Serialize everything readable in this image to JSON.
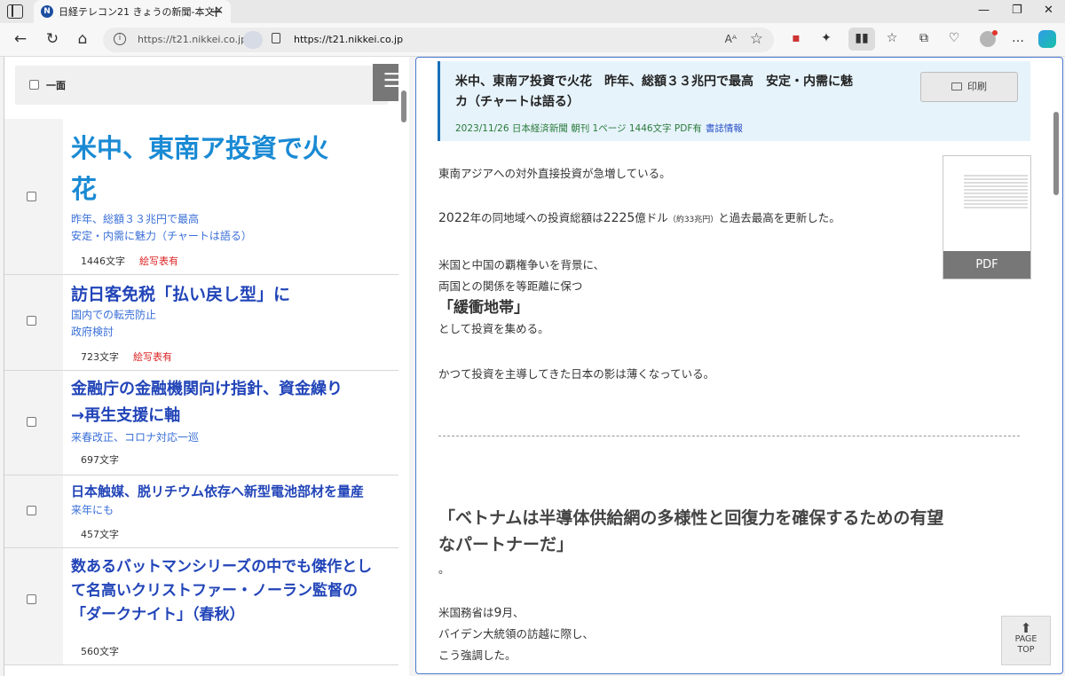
{
  "browser": {
    "tab_title": "日経テレコン21 きょうの新聞-本文",
    "address_host": "https://t21.nikkei.co.jp",
    "address_url": "https://t21.nikkei.co.jp"
  },
  "left": {
    "header_label": "一面",
    "menu_glyph": "☰",
    "articles": [
      {
        "title_line1": "米中、東南ア投資で火",
        "title_line2": "花",
        "sub_line1": "昨年、総額３３兆円で最高",
        "sub_line2": "安定・内需に魅力（チャートは語る）",
        "chars": "1446文字",
        "zu": "絵写表有"
      },
      {
        "title_line1": "訪日客免税「払い戻し型」に",
        "sub_line1": "国内での転売防止",
        "sub_line2": "政府検討",
        "chars": "723文字",
        "zu": "絵写表有"
      },
      {
        "title_line1": "金融庁の金融機関向け指針、資金繰り",
        "title_line2": "→再生支援に軸",
        "sub_line1": "来春改正、コロナ対応一巡",
        "chars": "697文字"
      },
      {
        "title_line1": "日本触媒、脱リチウム依存へ新型電池部材を量産",
        "sub_line1": "来年にも",
        "chars": "457文字"
      },
      {
        "title_line1": "数あるバットマンシリーズの中でも傑作とし",
        "title_line2": "て名高いクリストファー・ノーラン監督の",
        "title_line3": "「ダークナイト」（春秋）",
        "chars": "560文字"
      }
    ]
  },
  "article": {
    "title_line1": "米中、東南ア投資で火花　昨年、総額３３兆円で最高　安定・内需に魅",
    "title_line2": "カ（チャートは語る）",
    "meta": "2023/11/26 日本経済新聞 朝刊 1ページ 1446文字 PDF有",
    "biblio_link": "書誌情報",
    "print_label": "印刷",
    "pdf_label": "PDF",
    "p1": "東南アジアへの対外直接投資が急増している。",
    "p2_year": "2022",
    "p2_a": "年の同地域への投資総額は",
    "p2_amount": "2225",
    "p2_b": "億ドル",
    "p2_note": "（約33兆円）",
    "p2_c": "と過去最高を更新した。",
    "p3_line1": "米国と中国の覇権争いを背景に、",
    "p3_line2": "両国との関係を等距離に保つ",
    "p3_keyword": "「緩衝地帯」",
    "p3_line3": "として投資を集める。",
    "p4": "かつて投資を主導してきた日本の影は薄くなっている。",
    "quote_line1": "「ベトナムは半導体供給網の多様性と回復力を確保するための有望",
    "quote_line2": "なパートナーだ」",
    "quote_end": "。",
    "p5_line1": "米国務省は",
    "p5_month": "9",
    "p5_line1b": "月、",
    "p5_line2": "バイデン大統領の訪越に際し、",
    "p5_line3": "こう強調した。"
  },
  "page_top": {
    "line1": "PAGE",
    "line2": "TOP"
  }
}
